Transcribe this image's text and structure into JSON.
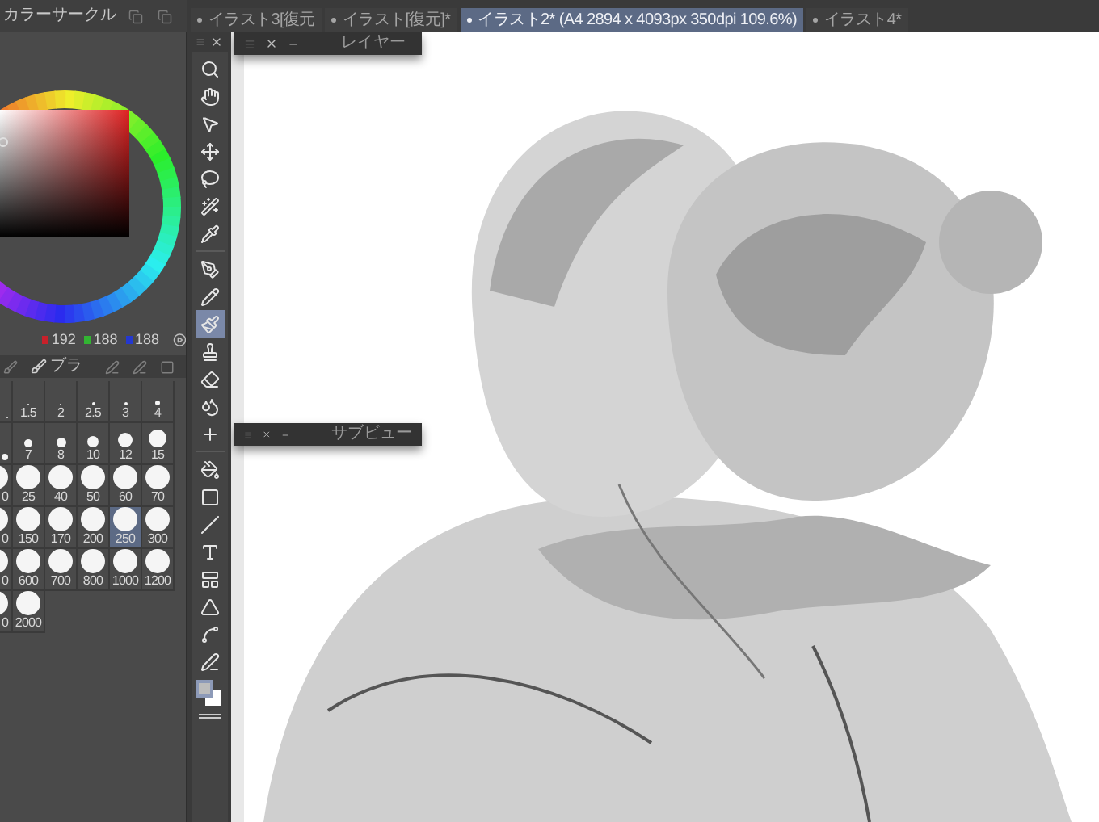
{
  "panel_title": "カラーサークル",
  "tabs": [
    {
      "label": "イラスト3[復元",
      "selected": false
    },
    {
      "label": "イラスト[復元]*",
      "selected": false
    },
    {
      "label": "イラスト2* (A4 2894 x 4093px 350dpi 109.6%)",
      "selected": true
    },
    {
      "label": "イラスト4*",
      "selected": false
    }
  ],
  "layer_panel": {
    "title": "レイヤー"
  },
  "subview_panel": {
    "title": "サブビュー"
  },
  "color_values": {
    "red": "192",
    "green": "188",
    "blue": "188"
  },
  "brush_tab": {
    "label": "ブラ"
  },
  "brush_sizes": [
    {
      "cells": [
        {
          "selected": false
        },
        {
          "label": "1.5",
          "selected": false
        },
        {
          "label": "2",
          "selected": false
        },
        {
          "label": "2.5",
          "selected": false
        },
        {
          "label": "3",
          "selected": false
        },
        {
          "label": "4",
          "selected": false
        }
      ]
    },
    {
      "cells": [
        {
          "selected": false
        },
        {
          "label": "7",
          "selected": false
        },
        {
          "label": "8",
          "selected": false
        },
        {
          "label": "10",
          "selected": false
        },
        {
          "label": "12",
          "selected": false
        },
        {
          "label": "15",
          "selected": false
        }
      ]
    },
    {
      "cells": [
        {
          "label": "0",
          "selected": false
        },
        {
          "label": "25",
          "selected": false
        },
        {
          "label": "40",
          "selected": false
        },
        {
          "label": "50",
          "selected": false
        },
        {
          "label": "60",
          "selected": false
        },
        {
          "label": "70",
          "selected": false
        }
      ]
    },
    {
      "cells": [
        {
          "label": "0",
          "selected": false
        },
        {
          "label": "150",
          "selected": false
        },
        {
          "label": "170",
          "selected": false
        },
        {
          "label": "200",
          "selected": false
        },
        {
          "label": "250",
          "selected": true
        },
        {
          "label": "300",
          "selected": false
        }
      ]
    },
    {
      "cells": [
        {
          "label": "0",
          "selected": false
        },
        {
          "label": "600",
          "selected": false
        },
        {
          "label": "700",
          "selected": false
        },
        {
          "label": "800",
          "selected": false
        },
        {
          "label": "1000",
          "selected": false
        },
        {
          "label": "1200",
          "selected": false
        }
      ]
    },
    {
      "cells": [
        {
          "label": "0",
          "selected": false
        },
        {
          "label": "2000",
          "selected": false
        }
      ]
    }
  ],
  "tools": [
    {
      "selected": false
    },
    {
      "selected": false
    },
    {
      "selected": false
    },
    {
      "selected": false
    },
    {
      "selected": false
    },
    {
      "selected": false
    },
    {
      "selected": false
    },
    {
      "selected": false
    },
    {
      "selected": false
    },
    {
      "selected": true
    },
    {
      "selected": false
    },
    {
      "selected": false
    },
    {
      "selected": false
    },
    {
      "selected": false
    },
    {
      "selected": false
    },
    {
      "selected": false
    },
    {
      "selected": false
    },
    {
      "selected": false
    },
    {
      "selected": false
    },
    {
      "selected": false
    },
    {
      "selected": false
    },
    {
      "selected": false
    }
  ]
}
